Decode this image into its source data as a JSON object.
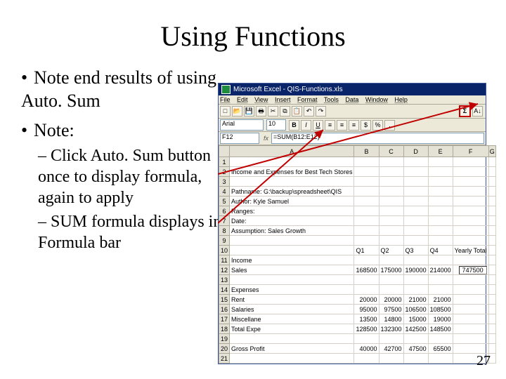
{
  "title": "Using Functions",
  "bullets": {
    "b1a": "Note end results of using Auto. Sum",
    "b1b": "Note:",
    "b2a": "Click Auto. Sum button once to display formula, again to apply",
    "b2b": "SUM formula displays in Formula bar"
  },
  "excel": {
    "titlebar": "Microsoft Excel - QIS-Functions.xls",
    "menus": {
      "file": "File",
      "edit": "Edit",
      "view": "View",
      "insert": "Insert",
      "format": "Format",
      "tools": "Tools",
      "data": "Data",
      "window": "Window",
      "help": "Help"
    },
    "fontname": "Arial",
    "fontsize": "10",
    "style": {
      "bold": "B",
      "italic": "I",
      "underline": "U"
    },
    "currency": "$",
    "percent": "%",
    "comma": ",",
    "namebox": "F12",
    "formula": "=SUM(B12:E12)",
    "colheads": [
      "A",
      "B",
      "C",
      "D",
      "E",
      "F",
      "G"
    ],
    "rows": [
      {
        "n": "1",
        "cells": [
          "",
          "",
          "",
          "",
          "",
          "",
          ""
        ]
      },
      {
        "n": "2",
        "cells": [
          "Income and Expenses for Best Tech Stores",
          "",
          "",
          "",
          "",
          "",
          ""
        ]
      },
      {
        "n": "3",
        "cells": [
          "",
          "",
          "",
          "",
          "",
          "",
          ""
        ]
      },
      {
        "n": "4",
        "cells": [
          "Pathname: G:\\backup\\spreadsheet\\QIS",
          "",
          "",
          "",
          "",
          "",
          ""
        ]
      },
      {
        "n": "5",
        "cells": [
          "Author: Kyle Samuel",
          "",
          "",
          "",
          "",
          "",
          ""
        ]
      },
      {
        "n": "6",
        "cells": [
          "Ranges:",
          "",
          "",
          "",
          "",
          "",
          ""
        ]
      },
      {
        "n": "7",
        "cells": [
          "Date:",
          "",
          "",
          "",
          "",
          "",
          ""
        ]
      },
      {
        "n": "8",
        "cells": [
          "Assumption: Sales Growth",
          "",
          "",
          "",
          "",
          "",
          ""
        ]
      },
      {
        "n": "9",
        "cells": [
          "",
          "",
          "",
          "",
          "",
          "",
          ""
        ]
      },
      {
        "n": "10",
        "cells": [
          "",
          "Q1",
          "Q2",
          "Q3",
          "Q4",
          "Yearly Total",
          ""
        ]
      },
      {
        "n": "11",
        "cells": [
          "Income",
          "",
          "",
          "",
          "",
          "",
          ""
        ]
      },
      {
        "n": "12",
        "cells": [
          "Sales",
          "168500",
          "175000",
          "190000",
          "214000",
          "747500",
          ""
        ]
      },
      {
        "n": "13",
        "cells": [
          "",
          "",
          "",
          "",
          "",
          "",
          ""
        ]
      },
      {
        "n": "14",
        "cells": [
          "Expenses",
          "",
          "",
          "",
          "",
          "",
          ""
        ]
      },
      {
        "n": "15",
        "cells": [
          "Rent",
          "20000",
          "20000",
          "21000",
          "21000",
          "",
          ""
        ]
      },
      {
        "n": "16",
        "cells": [
          "Salaries",
          "95000",
          "97500",
          "106500",
          "108500",
          "",
          ""
        ]
      },
      {
        "n": "17",
        "cells": [
          "Miscellane",
          "13500",
          "14800",
          "15000",
          "19000",
          "",
          ""
        ]
      },
      {
        "n": "18",
        "cells": [
          "Total Expe",
          "128500",
          "132300",
          "142500",
          "148500",
          "",
          ""
        ]
      },
      {
        "n": "19",
        "cells": [
          "",
          "",
          "",
          "",
          "",
          "",
          ""
        ]
      },
      {
        "n": "20",
        "cells": [
          "Gross Profit",
          "40000",
          "42700",
          "47500",
          "65500",
          "",
          ""
        ]
      },
      {
        "n": "21",
        "cells": [
          "",
          "",
          "",
          "",
          "",
          "",
          ""
        ]
      }
    ]
  },
  "pagenum": "27"
}
